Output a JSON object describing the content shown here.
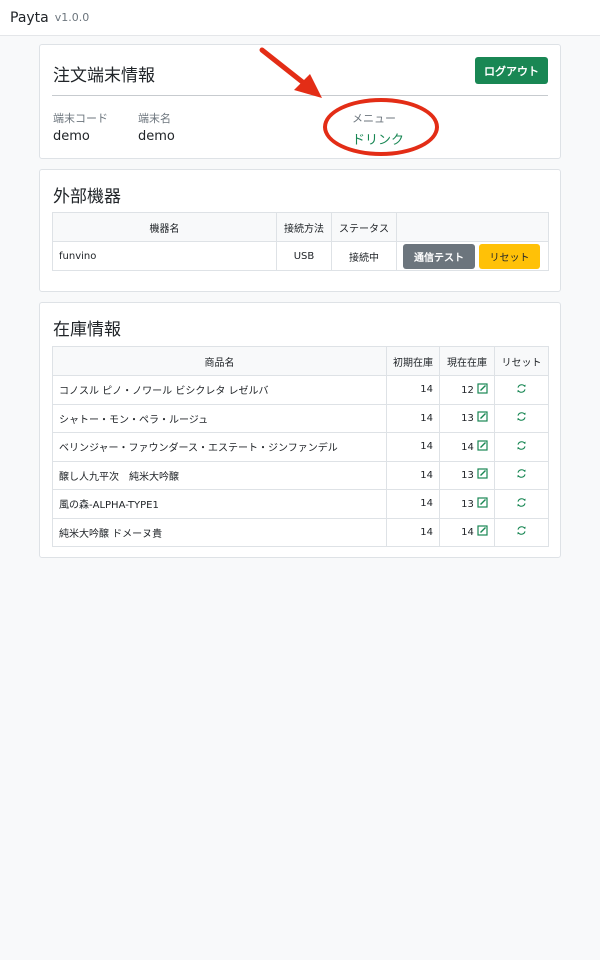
{
  "navbar": {
    "brand": "Payta",
    "version": "v1.0.0"
  },
  "terminal": {
    "title": "注文端末情報",
    "logout_label": "ログアウト",
    "fields": [
      {
        "label": "端末コード",
        "value": "demo"
      },
      {
        "label": "端末名",
        "value": "demo"
      },
      {
        "label": "メニュー",
        "value": "ドリンク"
      }
    ]
  },
  "devices": {
    "title": "外部機器",
    "headers": [
      "機器名",
      "接続方法",
      "ステータス",
      ""
    ],
    "rows": [
      {
        "name": "funvino",
        "method": "USB",
        "status": "接続中"
      }
    ],
    "test_label": "通信テスト",
    "reset_label": "リセット"
  },
  "stock": {
    "title": "在庫情報",
    "headers": [
      "商品名",
      "初期在庫",
      "現在在庫",
      "リセット"
    ],
    "rows": [
      {
        "name": "コノスル ピノ・ノワール ビシクレタ レゼルバ",
        "initial": "14",
        "current": "12"
      },
      {
        "name": "シャトー・モン・ペラ・ルージュ",
        "initial": "14",
        "current": "13"
      },
      {
        "name": "ベリンジャー・ファウンダース・エステート・ジンファンデル",
        "initial": "14",
        "current": "14"
      },
      {
        "name": "醸し人九平次　純米大吟醸",
        "initial": "14",
        "current": "13"
      },
      {
        "name": "風の森-ALPHA-TYPE1",
        "initial": "14",
        "current": "13"
      },
      {
        "name": "純米大吟醸 ドメーヌ貴",
        "initial": "14",
        "current": "14"
      }
    ]
  },
  "colors": {
    "success": "#198754",
    "secondary": "#6c757d",
    "warning": "#ffc107",
    "annotation": "#e32d16"
  }
}
